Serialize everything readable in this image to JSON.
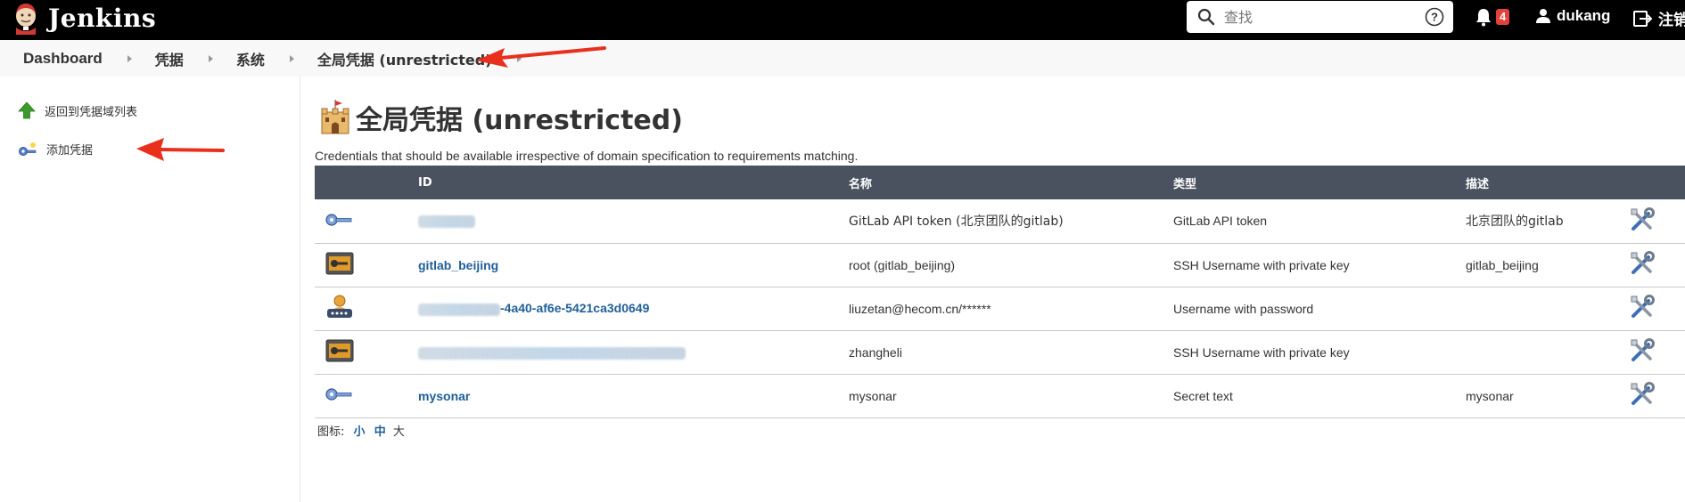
{
  "header": {
    "brand": "Jenkins",
    "search_placeholder": "查找",
    "notification_count": "4",
    "user_name": "dukang",
    "logout_label": "注销"
  },
  "breadcrumb": [
    "Dashboard",
    "凭据",
    "系统",
    "全局凭据 (unrestricted)"
  ],
  "side_tasks": [
    {
      "label": "返回到凭据域列表",
      "icon": "up-arrow-icon"
    },
    {
      "label": "添加凭据",
      "icon": "key-add-icon"
    }
  ],
  "main": {
    "title": "全局凭据 (unrestricted)",
    "description": "Credentials that should be available irrespective of domain specification to requirements matching.",
    "columns": [
      "ID",
      "名称",
      "类型",
      "描述"
    ],
    "rows": [
      {
        "icon": "key-icon",
        "id": "",
        "name": "GitLab API token (北京团队的gitlab)",
        "type": "GitLab API token",
        "description": "北京团队的gitlab"
      },
      {
        "icon": "ssh-key-icon",
        "id": "gitlab_beijing",
        "name": "root (gitlab_beijing)",
        "type": "SSH Username with private key",
        "description": "gitlab_beijing"
      },
      {
        "icon": "user-password-icon",
        "id": "-4a40-af6e-5421ca3d0649",
        "name": "liuzetan@hecom.cn/******",
        "type": "Username with password",
        "description": ""
      },
      {
        "icon": "ssh-key-icon",
        "id": "",
        "name": "zhangheli",
        "type": "SSH Username with private key",
        "description": ""
      },
      {
        "icon": "key-icon",
        "id": "mysonar",
        "name": "mysonar",
        "type": "Secret text",
        "description": "mysonar"
      }
    ],
    "icon_size": {
      "label": "图标:",
      "small": "小",
      "medium": "中",
      "large": "大"
    }
  },
  "colors": {
    "header_bg": "#000000",
    "table_header_bg": "#4a5260",
    "link": "#1f5f99",
    "badge": "#e3413b",
    "annotation": "#e8301c"
  }
}
